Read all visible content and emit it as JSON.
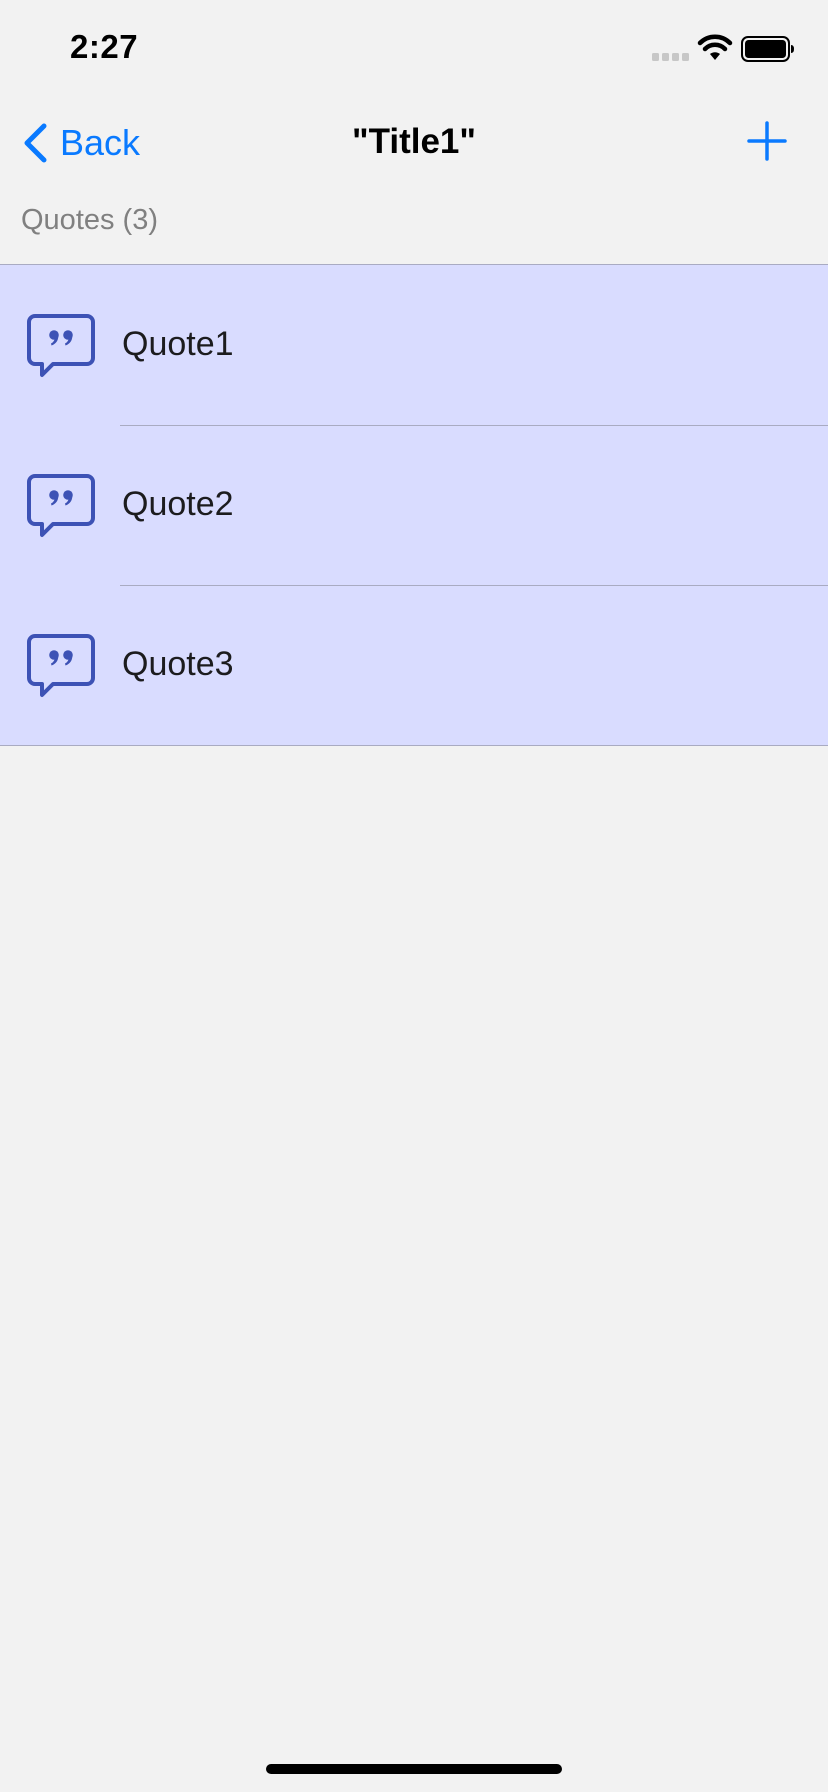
{
  "status_bar": {
    "time": "2:27"
  },
  "nav": {
    "back_label": "Back",
    "title": "\"Title1\"",
    "accent_color": "#0a7aff"
  },
  "section": {
    "header": "Quotes (3)"
  },
  "quotes": [
    {
      "label": "Quote1",
      "icon": "quote-bubble-icon"
    },
    {
      "label": "Quote2",
      "icon": "quote-bubble-icon"
    },
    {
      "label": "Quote3",
      "icon": "quote-bubble-icon"
    }
  ],
  "colors": {
    "background": "#f2f2f2",
    "list_background": "#d9dcff",
    "icon_color": "#3d52b5",
    "separator": "#a9abc2"
  }
}
